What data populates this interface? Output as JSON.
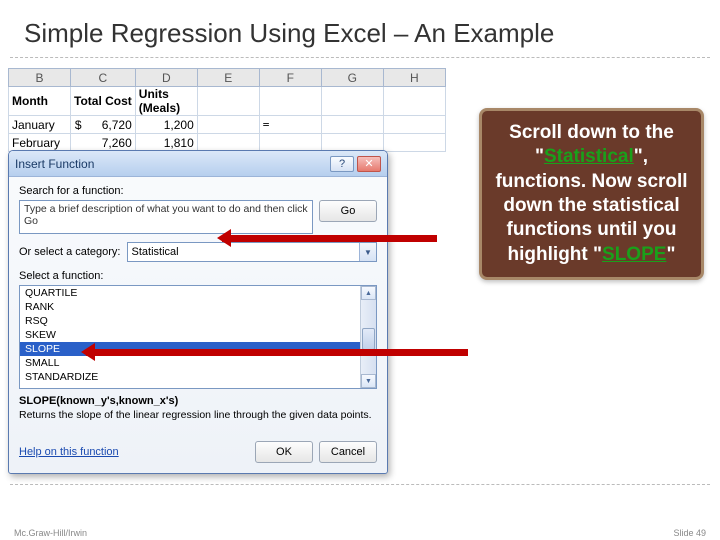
{
  "title": "Simple Regression Using Excel – An Example",
  "excel": {
    "cols": [
      "B",
      "C",
      "D",
      "E",
      "F",
      "G",
      "H"
    ],
    "headers": {
      "b": "Month",
      "c": "Total Cost",
      "d": "Units (Meals)"
    },
    "rows": [
      {
        "month": "January",
        "cost_sym": "$",
        "cost": "6,720",
        "units": "1,200",
        "formula": "="
      },
      {
        "month": "February",
        "cost_sym": "",
        "cost": "7,260",
        "units": "1,810",
        "formula": ""
      }
    ]
  },
  "dialog": {
    "title": "Insert Function",
    "help_q": "?",
    "close_x": "✕",
    "search_label": "Search for a function:",
    "search_value": "Type a brief description of what you want to do and then click Go",
    "go": "Go",
    "cat_label": "Or select a category:",
    "cat_value": "Statistical",
    "select_label": "Select a function:",
    "items": [
      "QUARTILE",
      "RANK",
      "RSQ",
      "SKEW",
      "SLOPE",
      "SMALL",
      "STANDARDIZE"
    ],
    "selected_index": 4,
    "signature": "SLOPE(known_y's,known_x's)",
    "description": "Returns the slope of the linear regression line through the given data points.",
    "help_link": "Help on this function",
    "ok": "OK",
    "cancel": "Cancel"
  },
  "callout": {
    "t1": "Scroll down to the \"",
    "stat": "Statistical",
    "t2": "\", functions. Now scroll down the statistical functions until you highlight \"",
    "slope": "SLOPE",
    "t3": "\""
  },
  "footer": {
    "left": "Mc.Graw-Hill/Irwin",
    "right": "Slide 49"
  }
}
